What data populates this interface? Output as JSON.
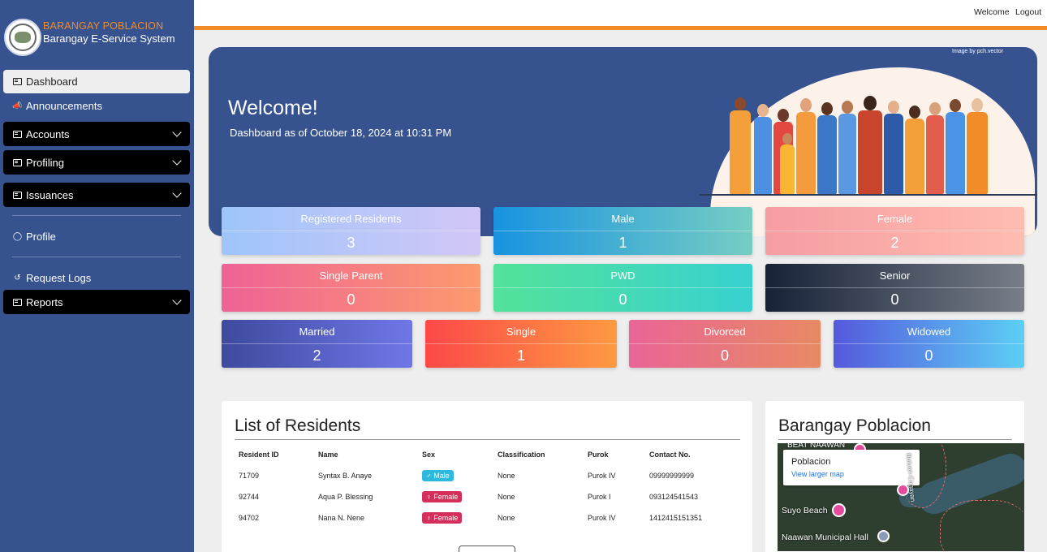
{
  "brand": {
    "name": "BARANGAY POBLACION",
    "system": "Barangay E-Service System"
  },
  "topbar": {
    "welcome": "Welcome",
    "logout": "Logout"
  },
  "sidebar": {
    "dashboard": "Dashboard",
    "announcements": "Announcements",
    "accounts": "Accounts",
    "profiling": "Profiling",
    "issuances": "Issuances",
    "profile": "Profile",
    "request_logs": "Request Logs",
    "reports": "Reports"
  },
  "hero": {
    "title": "Welcome!",
    "subtitle": "Dashboard as of October 18, 2024 at 10:31 PM",
    "credit": "Image by pch.vector"
  },
  "stats": {
    "registered": {
      "label": "Registered Residents",
      "value": "3"
    },
    "male": {
      "label": "Male",
      "value": "1"
    },
    "female": {
      "label": "Female",
      "value": "2"
    },
    "single_parent": {
      "label": "Single Parent",
      "value": "0"
    },
    "pwd": {
      "label": "PWD",
      "value": "0"
    },
    "senior": {
      "label": "Senior",
      "value": "0"
    },
    "married": {
      "label": "Married",
      "value": "2"
    },
    "single": {
      "label": "Single",
      "value": "1"
    },
    "divorced": {
      "label": "Divorced",
      "value": "0"
    },
    "widowed": {
      "label": "Widowed",
      "value": "0"
    }
  },
  "residents": {
    "title": "List of Residents",
    "headers": [
      "Resident ID",
      "Name",
      "Sex",
      "Classification",
      "Purok",
      "Contact No."
    ],
    "rows": [
      {
        "id": "71709",
        "name": "Syntax B. Anaye",
        "sex": "Male",
        "classification": "None",
        "purok": "Purok IV",
        "contact": "09999999999"
      },
      {
        "id": "92744",
        "name": "Aqua P. Blessing",
        "sex": "Female",
        "classification": "None",
        "purok": "Purok I",
        "contact": "093124541543"
      },
      {
        "id": "94702",
        "name": "Nana N. Nene",
        "sex": "Female",
        "classification": "None",
        "purok": "Purok IV",
        "contact": "1412415151351"
      }
    ]
  },
  "map": {
    "title": "Barangay Poblacion",
    "place": "Poblacion",
    "larger_map": "View larger map",
    "label_top": "BEAT NAAWAN",
    "label_beach": "Suyo Beach",
    "label_hall": "Naawan Municipal Hall",
    "label_road": "Butuan-Cagayan"
  },
  "colors": {
    "sidebar": "#36528f",
    "accent": "#f28c28",
    "male_badge": "#2cb9dd",
    "female_badge": "#d32f5a"
  }
}
